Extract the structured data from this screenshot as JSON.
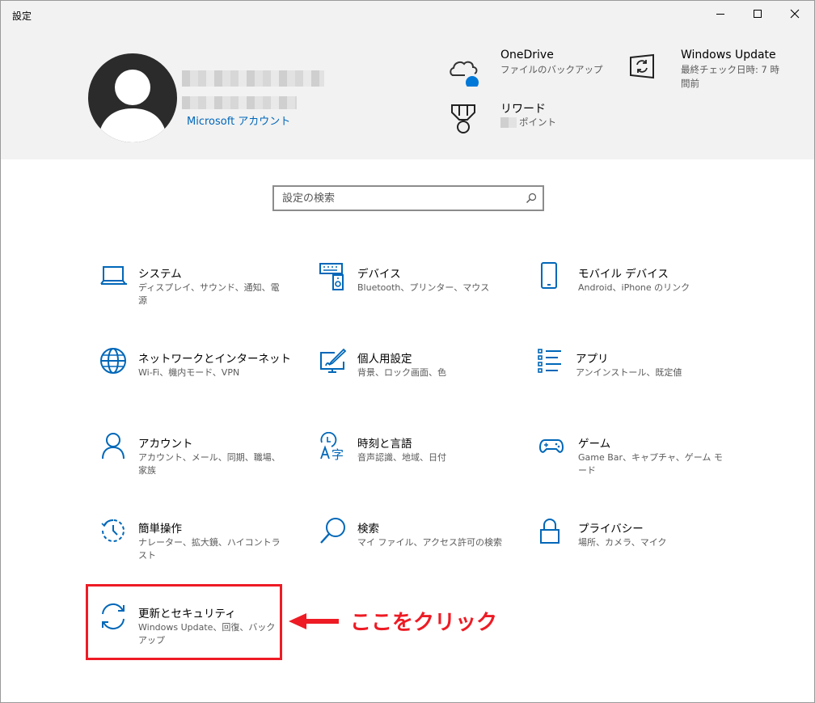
{
  "window": {
    "title": "設定"
  },
  "account": {
    "link_label": "Microsoft アカウント"
  },
  "header_items": {
    "onedrive": {
      "title": "OneDrive",
      "subtitle": "ファイルのバックアップ"
    },
    "windows_update": {
      "title": "Windows Update",
      "subtitle_line1": "最終チェック日時: 7 時",
      "subtitle_line2": "間前"
    },
    "rewards": {
      "title": "リワード",
      "subtitle": "ポイント"
    }
  },
  "search": {
    "placeholder": "設定の検索"
  },
  "tiles": [
    {
      "name": "システム",
      "desc": "ディスプレイ、サウンド、通知、電源",
      "icon": "laptop-icon"
    },
    {
      "name": "デバイス",
      "desc": "Bluetooth、プリンター、マウス",
      "icon": "keyboard-speaker-icon"
    },
    {
      "name": "モバイル デバイス",
      "desc": "Android、iPhone のリンク",
      "icon": "phone-icon"
    },
    {
      "name": "ネットワークとインターネット",
      "desc": "Wi-Fi、機内モード、VPN",
      "icon": "globe-icon"
    },
    {
      "name": "個人用設定",
      "desc": "背景、ロック画面、色",
      "icon": "paint-screen-icon"
    },
    {
      "name": "アプリ",
      "desc": "アンインストール、既定値",
      "icon": "app-list-icon"
    },
    {
      "name": "アカウント",
      "desc": "アカウント、メール、同期、職場、家族",
      "icon": "person-icon"
    },
    {
      "name": "時刻と言語",
      "desc": "音声認識、地域、日付",
      "icon": "time-language-icon"
    },
    {
      "name": "ゲーム",
      "desc": "Game Bar、キャプチャ、ゲーム モード",
      "icon": "gamepad-icon"
    },
    {
      "name": "簡単操作",
      "desc": "ナレーター、拡大鏡、ハイコントラスト",
      "icon": "ease-of-access-icon"
    },
    {
      "name": "検索",
      "desc": "マイ ファイル、アクセス許可の検索",
      "icon": "search-icon"
    },
    {
      "name": "プライバシー",
      "desc": "場所、カメラ、マイク",
      "icon": "lock-icon"
    },
    {
      "name": "更新とセキュリティ",
      "desc": "Windows Update、回復、バックアップ",
      "icon": "sync-icon"
    }
  ],
  "annotation": {
    "text": "ここをクリック",
    "color": "#ee1b24"
  },
  "colors": {
    "accent": "#0067b8",
    "header_bg": "#f2f2f2"
  }
}
